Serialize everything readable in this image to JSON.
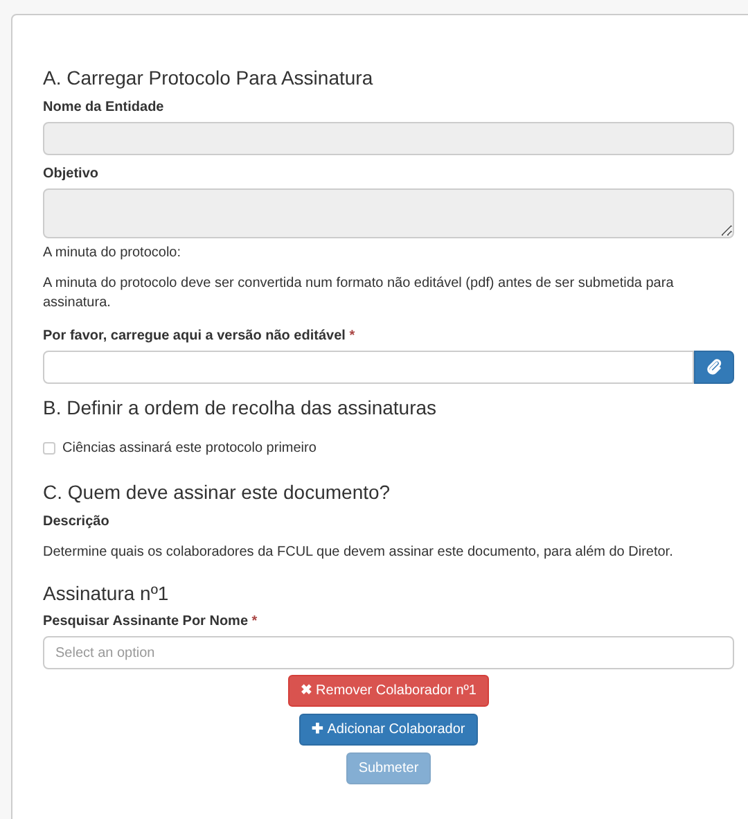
{
  "section_a": {
    "heading": "A. Carregar Protocolo Para Assinatura",
    "fields": [
      {
        "label": "Nome da Entidade",
        "kind": "input",
        "disabled": true
      },
      {
        "label": "Objetivo",
        "kind": "textarea",
        "disabled": true
      }
    ],
    "minuta_label": "A minuta do protocolo:",
    "note": "A minuta do protocolo deve ser convertida num formato não editável (pdf) antes de ser submetida para assinatura.",
    "upload": {
      "label": "Por favor, carregue aqui a versão não editável",
      "required_mark": "*"
    }
  },
  "section_b": {
    "heading": "B. Definir a ordem de recolha das assinaturas",
    "checkbox": {
      "label": "Ciências assinará este protocolo primeiro",
      "checked": false
    }
  },
  "section_c": {
    "heading": "C. Quem deve assinar este documento?",
    "description_label": "Descrição",
    "description": "Determine quais os colaboradores da FCUL que devem assinar este documento, para além do Diretor.",
    "signature": {
      "heading": "Assinatura nº1",
      "label": "Pesquisar Assinante Por Nome",
      "required_mark": "*",
      "placeholder": "Select an option"
    }
  },
  "buttons": [
    {
      "kind": "remove",
      "icon": "✖",
      "label": "Remover Colaborador nº1",
      "disabled": false
    },
    {
      "kind": "add",
      "icon": "✚",
      "label": "Adicionar Colaborador",
      "disabled": false
    },
    {
      "kind": "submit",
      "label": "Submeter",
      "disabled": true
    }
  ]
}
